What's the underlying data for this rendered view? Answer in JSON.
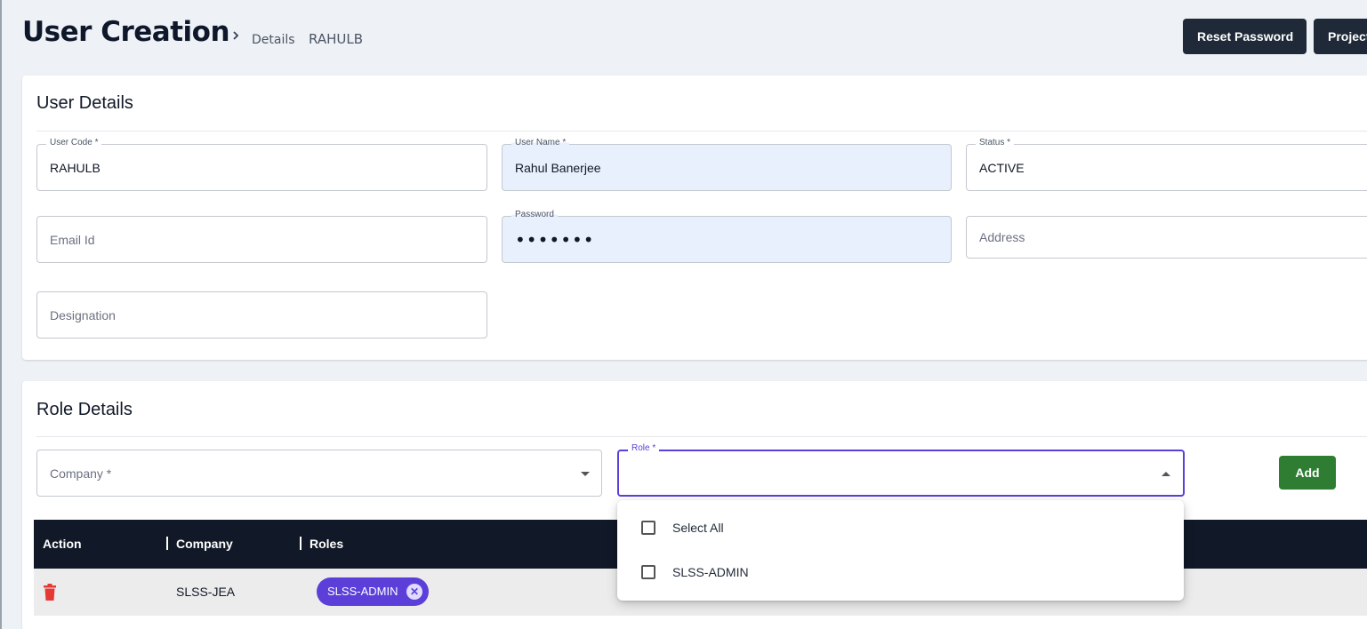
{
  "header": {
    "title": "User Creation",
    "breadcrumb": {
      "parent": "Details",
      "current": "RAHULB"
    },
    "buttons": {
      "reset_password": "Reset Password",
      "project": "Projects"
    }
  },
  "user_details": {
    "title": "User Details",
    "fields": {
      "user_code": {
        "label": "User Code *",
        "value": "RAHULB"
      },
      "user_name": {
        "label": "User Name *",
        "value": "Rahul Banerjee"
      },
      "status": {
        "label": "Status *",
        "value": "ACTIVE"
      },
      "email": {
        "placeholder": "Email Id"
      },
      "password": {
        "label": "Password",
        "value": "•••••••"
      },
      "address": {
        "placeholder": "Address"
      },
      "designation": {
        "placeholder": "Designation"
      }
    }
  },
  "role_details": {
    "title": "Role Details",
    "company": {
      "placeholder": "Company *"
    },
    "role": {
      "label": "Role *",
      "value": ""
    },
    "add_label": "Add",
    "table": {
      "columns": [
        "Action",
        "Company",
        "Roles"
      ],
      "rows": [
        {
          "company": "SLSS-JEA",
          "roles": [
            "SLSS-ADMIN"
          ]
        }
      ]
    },
    "role_options": [
      "Select All",
      "SLSS-ADMIN"
    ]
  },
  "colors": {
    "primary_dark": "#1f2937",
    "accent_purple": "#5b3fd8",
    "add_green": "#2e7d32",
    "delete_red": "#e53935"
  }
}
